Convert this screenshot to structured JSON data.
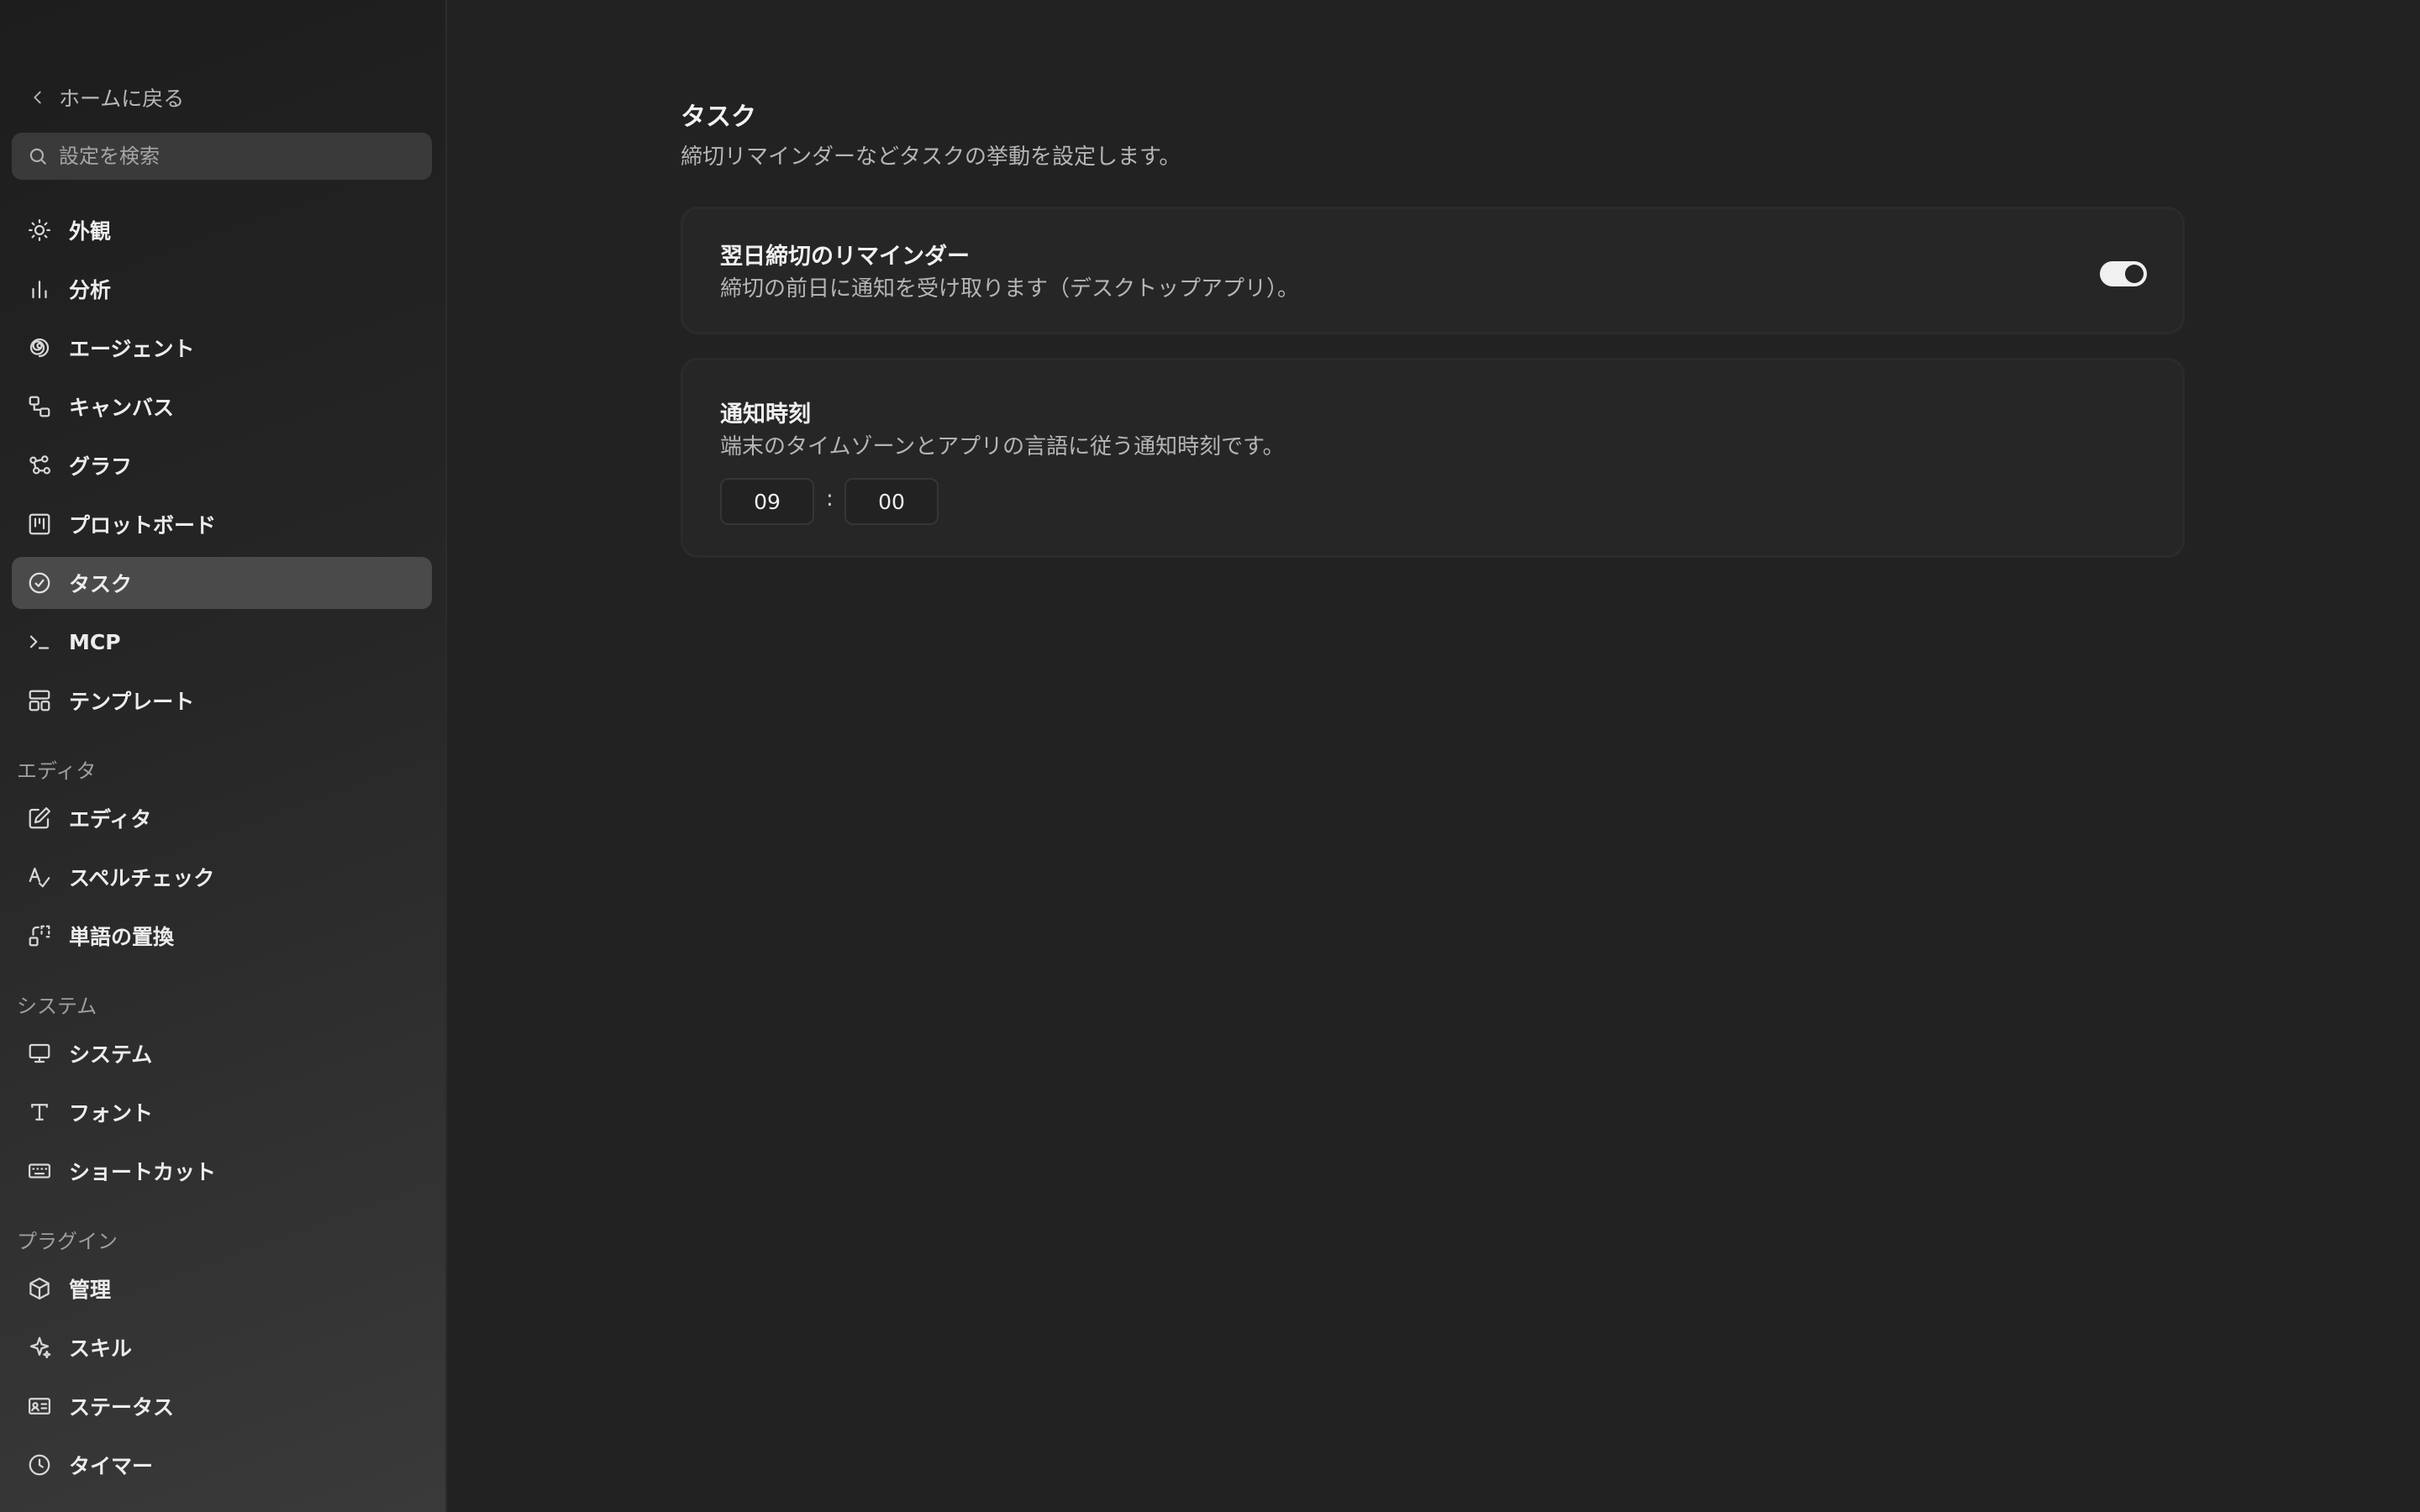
{
  "sidebar": {
    "back_label": "ホームに戻る",
    "search_placeholder": "設定を検索",
    "items": [
      {
        "label": "外観",
        "icon": "sun-icon"
      },
      {
        "label": "分析",
        "icon": "bar-chart-icon"
      },
      {
        "label": "エージェント",
        "icon": "spiral-icon"
      },
      {
        "label": "キャンバス",
        "icon": "canvas-icon"
      },
      {
        "label": "グラフ",
        "icon": "graph-icon"
      },
      {
        "label": "プロットボード",
        "icon": "board-icon"
      },
      {
        "label": "タスク",
        "icon": "check-circle-icon",
        "active": true
      },
      {
        "label": "MCP",
        "icon": "terminal-icon"
      },
      {
        "label": "テンプレート",
        "icon": "template-icon"
      }
    ],
    "sections": {
      "editor": {
        "label": "エディタ",
        "items": [
          {
            "label": "エディタ",
            "icon": "edit-icon"
          },
          {
            "label": "スペルチェック",
            "icon": "spellcheck-icon"
          },
          {
            "label": "単語の置換",
            "icon": "replace-icon"
          }
        ]
      },
      "system": {
        "label": "システム",
        "items": [
          {
            "label": "システム",
            "icon": "monitor-icon"
          },
          {
            "label": "フォント",
            "icon": "type-icon"
          },
          {
            "label": "ショートカット",
            "icon": "keyboard-icon"
          }
        ]
      },
      "plugins": {
        "label": "プラグイン",
        "items": [
          {
            "label": "管理",
            "icon": "package-icon"
          },
          {
            "label": "スキル",
            "icon": "sparkle-icon"
          },
          {
            "label": "ステータス",
            "icon": "id-card-icon"
          },
          {
            "label": "タイマー",
            "icon": "clock-icon"
          }
        ]
      }
    }
  },
  "main": {
    "title": "タスク",
    "description": "締切リマインダーなどタスクの挙動を設定します。",
    "reminder": {
      "title": "翌日締切のリマインダー",
      "description": "締切の前日に通知を受け取ります（デスクトップアプリ）。",
      "enabled": true
    },
    "notify_time": {
      "title": "通知時刻",
      "description": "端末のタイムゾーンとアプリの言語に従う通知時刻です。",
      "hour": "09",
      "separator": ":",
      "minute": "00"
    }
  },
  "colors": {
    "background": "#222222",
    "sidebar_active": "#4a4a4a",
    "toggle_on": "#f0f0f0"
  }
}
